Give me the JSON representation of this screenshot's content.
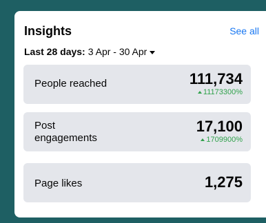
{
  "insights": {
    "title": "Insights",
    "see_all": "See all",
    "range_label": "Last 28 days:",
    "range_value": "3 Apr - 30 Apr",
    "metrics": [
      {
        "label": "People reached",
        "value": "111,734",
        "change": "11173300%"
      },
      {
        "label": "Post\nengagements",
        "value": "17,100",
        "change": "1709900%"
      },
      {
        "label": "Page likes",
        "value": "1,275",
        "change": ""
      }
    ]
  },
  "colors": {
    "background": "#1e5f63",
    "card": "#ffffff",
    "metric_bg": "#e4e6eb",
    "link": "#1877f2",
    "positive": "#31a24c"
  },
  "icons": {
    "range_dropdown": "caret-down-icon",
    "trend": "trend-up-icon"
  }
}
